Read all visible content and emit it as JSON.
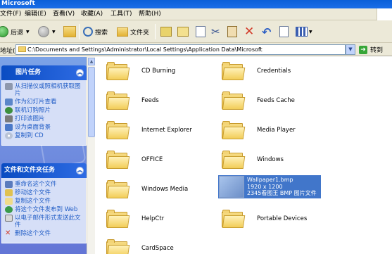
{
  "window": {
    "title": "Microsoft"
  },
  "menu": [
    {
      "label": "文件(F)"
    },
    {
      "label": "编辑(E)"
    },
    {
      "label": "查看(V)"
    },
    {
      "label": "收藏(A)"
    },
    {
      "label": "工具(T)"
    },
    {
      "label": "帮助(H)"
    }
  ],
  "toolbar": {
    "back_label": "后退",
    "search_label": "搜索",
    "folders_label": "文件夹"
  },
  "address": {
    "label": "地址(D)",
    "value": "C:\\Documents and Settings\\Administrator\\Local Settings\\Application Data\\Microsoft",
    "go_label": "转到"
  },
  "picture_tasks": {
    "title": "图片任务",
    "items": [
      {
        "label": "从扫描仪或照相机获取图片",
        "icon": "scanner-icon"
      },
      {
        "label": "作为幻灯片查看",
        "icon": "slideshow-icon"
      },
      {
        "label": "联机订购照片",
        "icon": "order-prints-icon"
      },
      {
        "label": "打印该图片",
        "icon": "printer-icon"
      },
      {
        "label": "设为桌面背景",
        "icon": "desktop-icon"
      },
      {
        "label": "复制到 CD",
        "icon": "cd-icon"
      }
    ]
  },
  "file_tasks": {
    "title": "文件和文件夹任务",
    "items": [
      {
        "label": "重命名这个文件",
        "icon": "rename-icon"
      },
      {
        "label": "移动这个文件",
        "icon": "move-icon"
      },
      {
        "label": "复制这个文件",
        "icon": "copy-icon"
      },
      {
        "label": "将这个文件发布到 Web",
        "icon": "web-publish-icon"
      },
      {
        "label": "以电子邮件形式发送此文件",
        "icon": "email-icon"
      },
      {
        "label": "删除这个文件",
        "icon": "delete-icon"
      }
    ]
  },
  "files": [
    {
      "name": "CD Burning"
    },
    {
      "name": "Credentials"
    },
    {
      "name": "Feeds"
    },
    {
      "name": "Feeds Cache"
    },
    {
      "name": "Internet Explorer"
    },
    {
      "name": "Media Player"
    },
    {
      "name": "OFFICE"
    },
    {
      "name": "Windows"
    },
    {
      "name": "Windows Media"
    },
    {
      "name": "HelpCtr"
    },
    {
      "name": "Portable Devices"
    },
    {
      "name": "CardSpace"
    }
  ],
  "selected_file": {
    "name": "Wallpaper1.bmp",
    "dimensions": "1920 x 1200",
    "info": "2345看图王 BMP 图片文件"
  },
  "colors": {
    "selection": "#316ac5",
    "taskpane_bg": "#6f8ce0",
    "folder": "#f2cd58"
  }
}
